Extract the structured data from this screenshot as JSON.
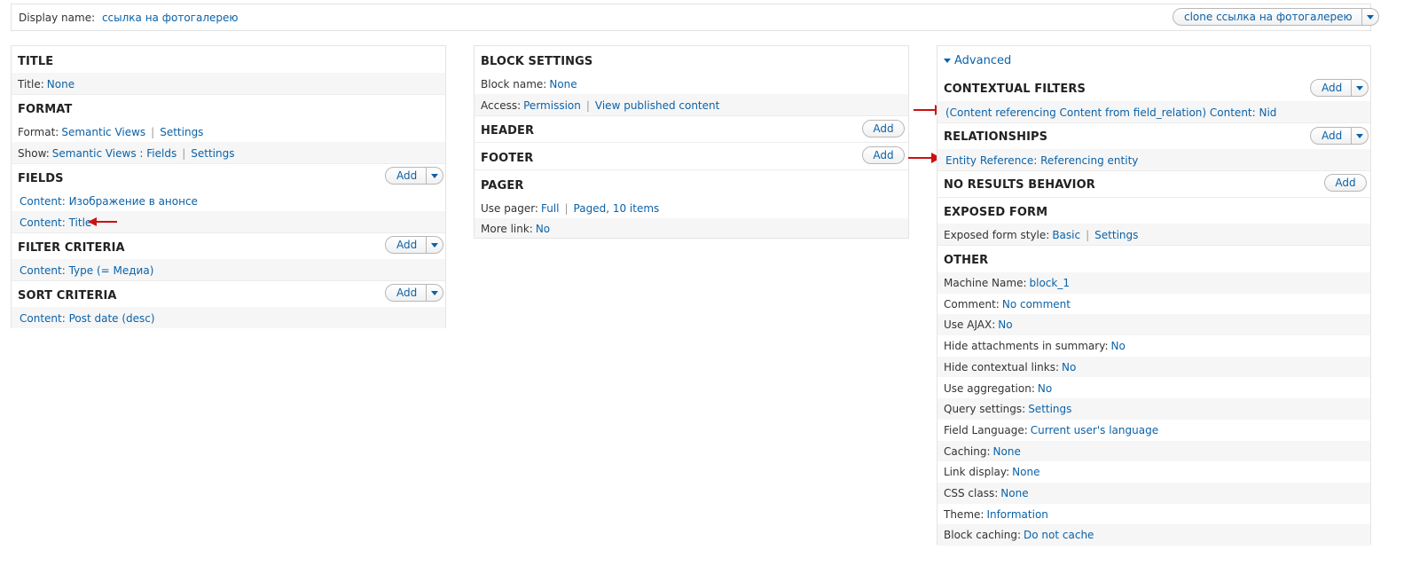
{
  "display": {
    "label": "Display name:",
    "name": "ссылка на фотогалерею",
    "clone_button": "clone ссылка на фотогалерею"
  },
  "left": {
    "title_section": {
      "heading": "TITLE",
      "row_label": "Title:",
      "row_value": "None"
    },
    "format_section": {
      "heading": "FORMAT",
      "format_label": "Format:",
      "format_value": "Semantic Views",
      "format_settings": "Settings",
      "show_label": "Show:",
      "show_value": "Semantic Views : Fields",
      "show_settings": "Settings"
    },
    "fields_section": {
      "heading": "FIELDS",
      "add": "Add",
      "items": [
        "Content: Изображение в анонсе",
        "Content: Title"
      ]
    },
    "filter_section": {
      "heading": "FILTER CRITERIA",
      "add": "Add",
      "items": [
        "Content: Type (= Медиа)"
      ]
    },
    "sort_section": {
      "heading": "SORT CRITERIA",
      "add": "Add",
      "items": [
        "Content: Post date (desc)"
      ]
    }
  },
  "middle": {
    "block_section": {
      "heading": "BLOCK SETTINGS",
      "name_label": "Block name:",
      "name_value": "None",
      "access_label": "Access:",
      "access_value": "Permission",
      "access_extra": "View published content"
    },
    "header_section": {
      "heading": "HEADER",
      "add": "Add"
    },
    "footer_section": {
      "heading": "FOOTER",
      "add": "Add"
    },
    "pager_section": {
      "heading": "PAGER",
      "use_label": "Use pager:",
      "use_value": "Full",
      "use_extra": "Paged, 10 items",
      "more_label": "More link:",
      "more_value": "No"
    }
  },
  "right": {
    "advanced_label": "Advanced",
    "contextual": {
      "heading": "CONTEXTUAL FILTERS",
      "add": "Add",
      "item": "(Content referencing Content from field_relation) Content: Nid"
    },
    "relationships": {
      "heading": "RELATIONSHIPS",
      "add": "Add",
      "item": "Entity Reference: Referencing entity"
    },
    "no_results": {
      "heading": "NO RESULTS BEHAVIOR",
      "add": "Add"
    },
    "exposed": {
      "heading": "EXPOSED FORM",
      "label": "Exposed form style:",
      "value": "Basic",
      "settings": "Settings"
    },
    "other": {
      "heading": "OTHER",
      "rows": [
        {
          "label": "Machine Name:",
          "value": "block_1"
        },
        {
          "label": "Comment:",
          "value": "No comment"
        },
        {
          "label": "Use AJAX:",
          "value": "No"
        },
        {
          "label": "Hide attachments in summary:",
          "value": "No"
        },
        {
          "label": "Hide contextual links:",
          "value": "No"
        },
        {
          "label": "Use aggregation:",
          "value": "No"
        },
        {
          "label": "Query settings:",
          "value": "Settings"
        },
        {
          "label": "Field Language:",
          "value": "Current user's language"
        },
        {
          "label": "Caching:",
          "value": "None"
        },
        {
          "label": "Link display:",
          "value": "None"
        },
        {
          "label": "CSS class:",
          "value": "None"
        },
        {
          "label": "Theme:",
          "value": "Information"
        },
        {
          "label": "Block caching:",
          "value": "Do not cache"
        }
      ]
    }
  },
  "colors": {
    "link": "#0b62a8",
    "arrow": "#cc1111",
    "row_shade": "#f6f6f6"
  },
  "icons": {
    "dropdown": "chevron-down-icon",
    "annotation": "red-arrow-icon",
    "advanced": "triangle-down-icon"
  }
}
